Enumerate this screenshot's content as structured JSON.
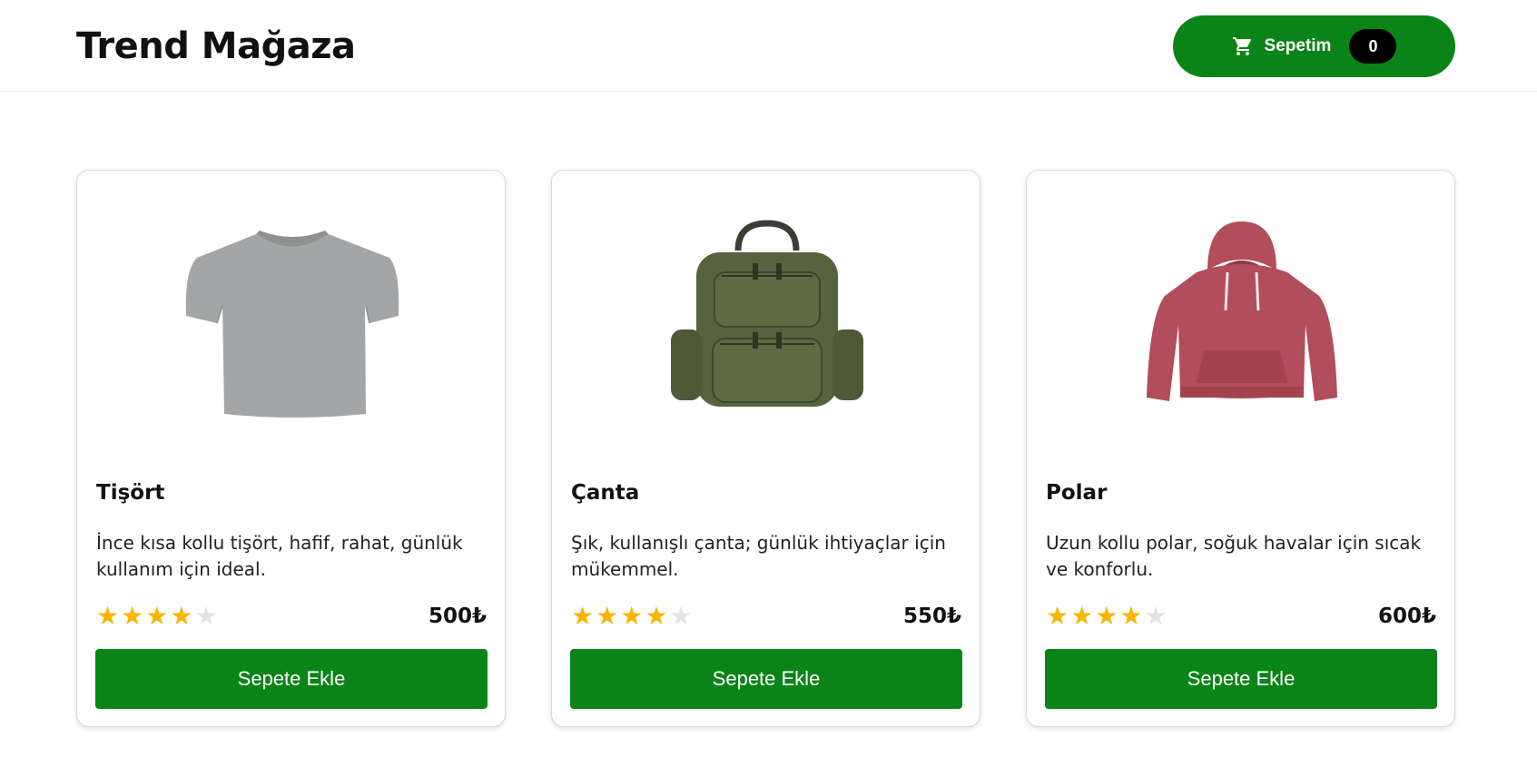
{
  "header": {
    "brand": "Trend Mağaza",
    "cart": {
      "label": "Sepetim",
      "count": "0",
      "icon": "cart-icon"
    }
  },
  "colors": {
    "accent": "#0a8417",
    "star": "#f8b500",
    "star_off": "#e3e3e3"
  },
  "products": [
    {
      "title": "Tişört",
      "description": "İnce kısa kollu tişört, hafif, rahat, günlük kullanım için ideal.",
      "rating": 4,
      "rating_max": 5,
      "price": "500₺",
      "button": "Sepete Ekle",
      "image": "gray-tshirt"
    },
    {
      "title": "Çanta",
      "description": "Şık, kullanışlı çanta; günlük ihtiyaçlar için mükemmel.",
      "rating": 4,
      "rating_max": 5,
      "price": "550₺",
      "button": "Sepete Ekle",
      "image": "green-backpack"
    },
    {
      "title": "Polar",
      "description": "Uzun kollu polar, soğuk havalar için sıcak ve konforlu.",
      "rating": 4,
      "rating_max": 5,
      "price": "600₺",
      "button": "Sepete Ekle",
      "image": "red-hoodie"
    }
  ]
}
